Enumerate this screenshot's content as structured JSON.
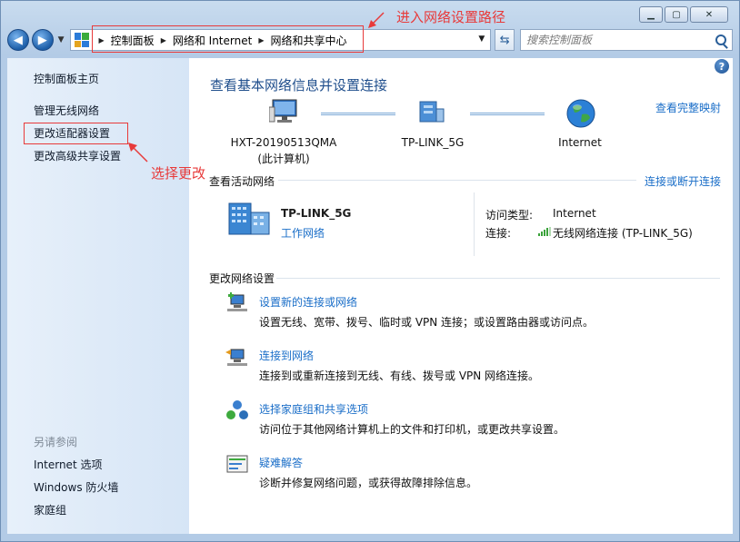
{
  "navigation": {
    "back_icon": "back-arrow-icon",
    "forward_icon": "forward-arrow-icon",
    "breadcrumbs": [
      "控制面板",
      "网络和 Internet",
      "网络和共享中心"
    ],
    "search_placeholder": "搜索控制面板"
  },
  "sidebar": {
    "items": [
      {
        "label": "控制面板主页"
      },
      {
        "label": "管理无线网络"
      },
      {
        "label": "更改适配器设置"
      },
      {
        "label": "更改高级共享设置"
      }
    ],
    "see_also_label": "另请参阅",
    "see_also": [
      {
        "label": "Internet 选项"
      },
      {
        "label": "Windows 防火墙"
      },
      {
        "label": "家庭组"
      }
    ]
  },
  "main": {
    "title": "查看基本网络信息并设置连接",
    "view_full_map": "查看完整映射",
    "map": {
      "computer_name": "HXT-20190513QMA",
      "computer_sub": "(此计算机)",
      "router": "TP-LINK_5G",
      "internet": "Internet"
    },
    "active_networks_label": "查看活动网络",
    "connect_disconnect": "连接或断开连接",
    "active_network": {
      "name": "TP-LINK_5G",
      "type_link": "工作网络",
      "access_type_label": "访问类型:",
      "access_type_value": "Internet",
      "connection_label": "连接:",
      "connection_value": "无线网络连接 (TP-LINK_5G)"
    },
    "change_settings_label": "更改网络设置",
    "tasks": [
      {
        "title": "设置新的连接或网络",
        "desc": "设置无线、宽带、拨号、临时或 VPN 连接；或设置路由器或访问点。",
        "icon": "new-connection-icon"
      },
      {
        "title": "连接到网络",
        "desc": "连接到或重新连接到无线、有线、拨号或 VPN 网络连接。",
        "icon": "connect-network-icon"
      },
      {
        "title": "选择家庭组和共享选项",
        "desc": "访问位于其他网络计算机上的文件和打印机，或更改共享设置。",
        "icon": "homegroup-icon"
      },
      {
        "title": "疑难解答",
        "desc": "诊断并修复网络问题，或获得故障排除信息。",
        "icon": "troubleshoot-icon"
      }
    ]
  },
  "annotations": {
    "path_note": "进入网络设置路径",
    "select_note": "选择更改",
    "color": "#e83a3a"
  }
}
